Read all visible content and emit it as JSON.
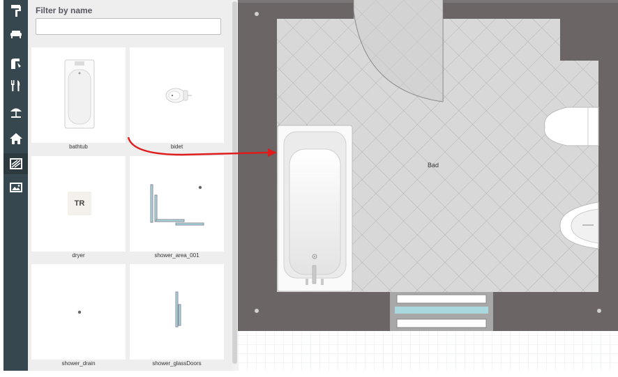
{
  "sidebar": {
    "tools": [
      {
        "icon": "paint-roller-icon"
      },
      {
        "icon": "sofa-icon"
      },
      {
        "icon": "sink-faucet-icon"
      },
      {
        "icon": "fork-knife-icon"
      },
      {
        "icon": "beach-umbrella-icon"
      },
      {
        "icon": "house-icon"
      },
      {
        "icon": "bathroom-icon",
        "active": true
      },
      {
        "icon": "picture-icon"
      }
    ]
  },
  "catalog": {
    "filter_label": "Filter by name",
    "filter_value": "",
    "items": [
      {
        "label": "bathtub"
      },
      {
        "label": "bidet"
      },
      {
        "label": "dryer",
        "icon_text": "TR"
      },
      {
        "label": "shower_area_001"
      },
      {
        "label": "shower_drain"
      },
      {
        "label": "shower_glassDoors"
      }
    ]
  },
  "canvas": {
    "room_label": "Bad"
  },
  "colors": {
    "rail": "#37474f",
    "wall": "#6b6566",
    "floor": "#d8d8d8",
    "arrow": "#e01b1b",
    "glass": "#a9d8df"
  }
}
